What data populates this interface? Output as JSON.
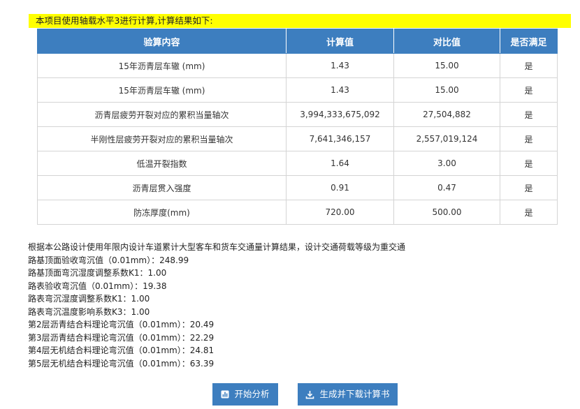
{
  "notice": "本项目使用轴载水平3进行计算,计算结果如下:",
  "table": {
    "headers": [
      "验算内容",
      "计算值",
      "对比值",
      "是否满足"
    ],
    "rows": [
      [
        "15年沥青层车辙 (mm)",
        "1.43",
        "15.00",
        "是"
      ],
      [
        "15年沥青层车辙 (mm)",
        "1.43",
        "15.00",
        "是"
      ],
      [
        "沥青层疲劳开裂对应的累积当量轴次",
        "3,994,333,675,092",
        "27,504,882",
        "是"
      ],
      [
        "半刚性层疲劳开裂对应的累积当量轴次",
        "7,641,346,157",
        "2,557,019,124",
        "是"
      ],
      [
        "低温开裂指数",
        "1.64",
        "3.00",
        "是"
      ],
      [
        "沥青层贯入强度",
        "0.91",
        "0.47",
        "是"
      ],
      [
        "防冻厚度(mm)",
        "720.00",
        "500.00",
        "是"
      ]
    ]
  },
  "info_lines": [
    "根据本公路设计使用年限内设计车道累计大型客车和货车交通量计算结果，设计交通荷载等级为重交通",
    "路基顶面验收弯沉值（0.01mm）：248.99",
    "路基顶面弯沉湿度调整系数K1：1.00",
    "路表验收弯沉值（0.01mm）：19.38",
    "路表弯沉湿度调整系数K1：1.00",
    "路表弯沉温度影响系数K3：1.00",
    "第2层沥青结合料理论弯沉值（0.01mm）：20.49",
    "第3层沥青结合料理论弯沉值（0.01mm）：22.29",
    "第4层无机结合料理论弯沉值（0.01mm）：24.81",
    "第5层无机结合料理论弯沉值（0.01mm）：63.39"
  ],
  "buttons": {
    "analyze_label": "开始分析",
    "analyze_icon": "chart-icon",
    "download_label": "生成并下载计算书",
    "download_icon": "download-icon"
  },
  "colors": {
    "notice_bg": "#ffff00",
    "header_bg": "#3d7ebf",
    "button_bg": "#3d7ebf"
  }
}
